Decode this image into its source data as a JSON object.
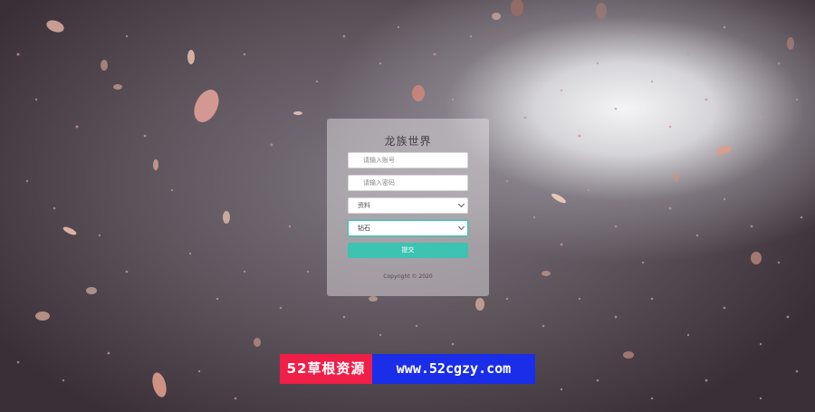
{
  "login": {
    "title": "龙族世界",
    "account_placeholder": "请输入账号",
    "password_placeholder": "请输入密码",
    "server_select": {
      "selected": "资料"
    },
    "item_select": {
      "selected": "钻石"
    },
    "submit_label": "提交",
    "copyright": "Copyright © 2020"
  },
  "watermark": {
    "left_text": "52草根资源",
    "right_text": "www.52cgzy.com",
    "left_color": "#f01f48",
    "right_color": "#1a2de8"
  },
  "colors": {
    "accent": "#3cc3b1"
  }
}
